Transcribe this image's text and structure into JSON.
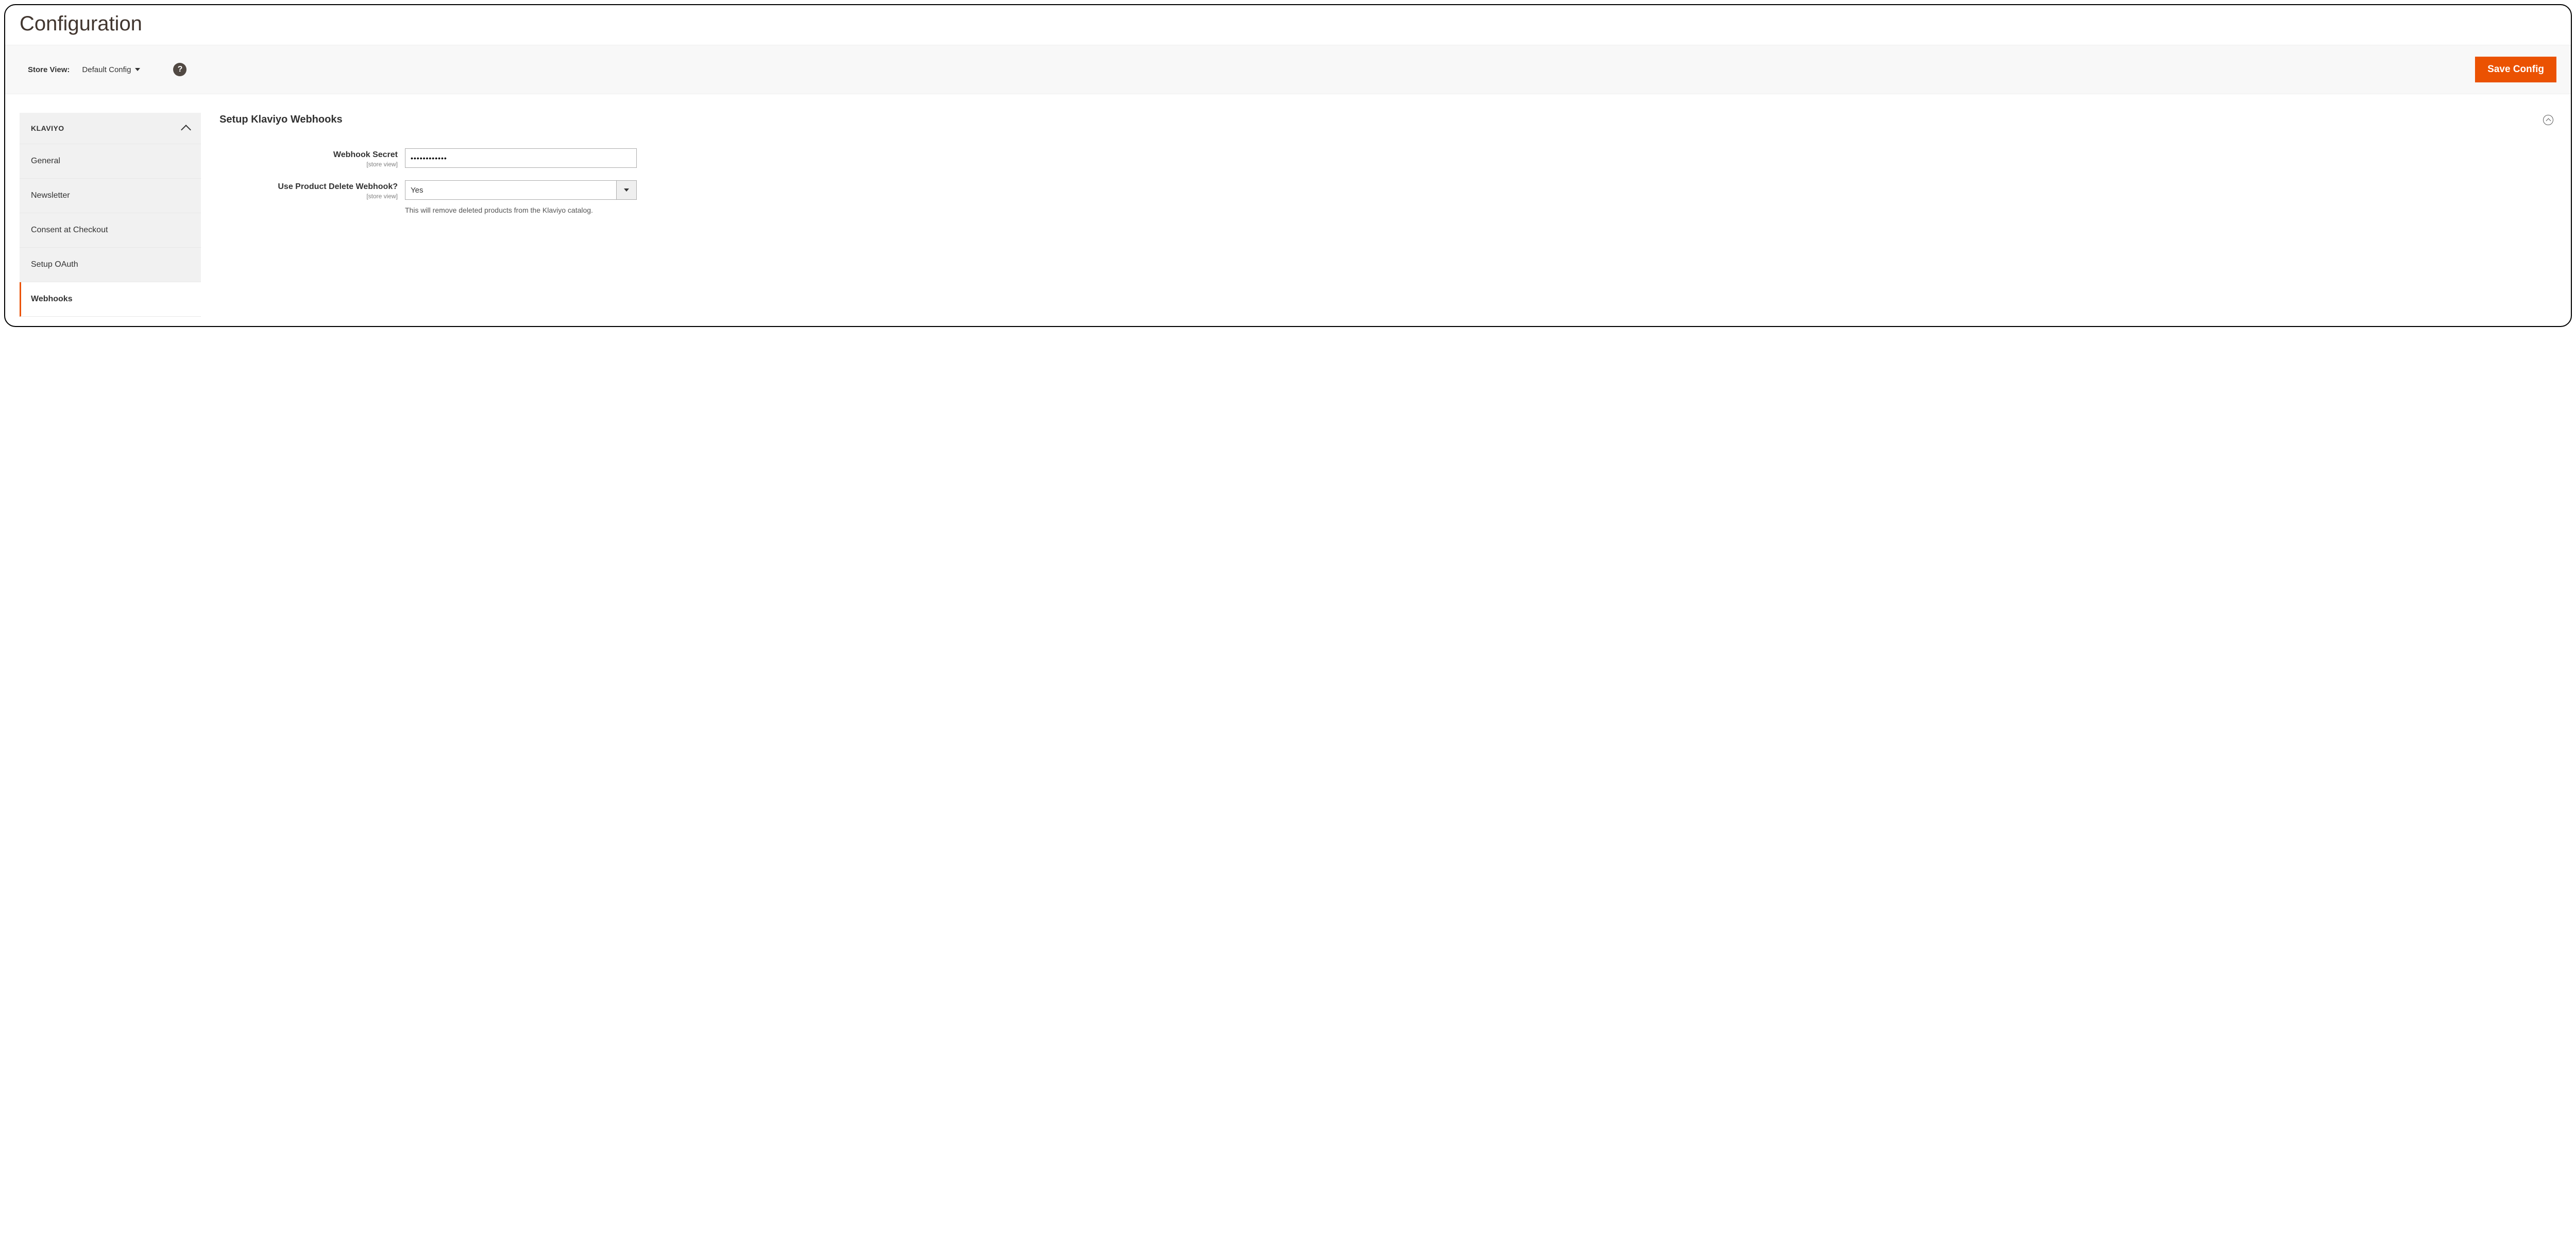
{
  "page": {
    "title": "Configuration"
  },
  "toolbar": {
    "store_view_label": "Store View:",
    "store_view_value": "Default Config",
    "help_icon": "?",
    "save_label": "Save Config"
  },
  "sidebar": {
    "group_label": "KLAVIYO",
    "items": [
      {
        "label": "General",
        "active": false
      },
      {
        "label": "Newsletter",
        "active": false
      },
      {
        "label": "Consent at Checkout",
        "active": false
      },
      {
        "label": "Setup OAuth",
        "active": false
      },
      {
        "label": "Webhooks",
        "active": true
      }
    ]
  },
  "main": {
    "section_title": "Setup Klaviyo Webhooks",
    "fields": {
      "webhook_secret": {
        "label": "Webhook Secret",
        "scope": "[store view]",
        "value": "••••••••••••"
      },
      "use_product_delete": {
        "label": "Use Product Delete Webhook?",
        "scope": "[store view]",
        "value": "Yes",
        "note": "This will remove deleted products from the Klaviyo catalog."
      }
    }
  }
}
